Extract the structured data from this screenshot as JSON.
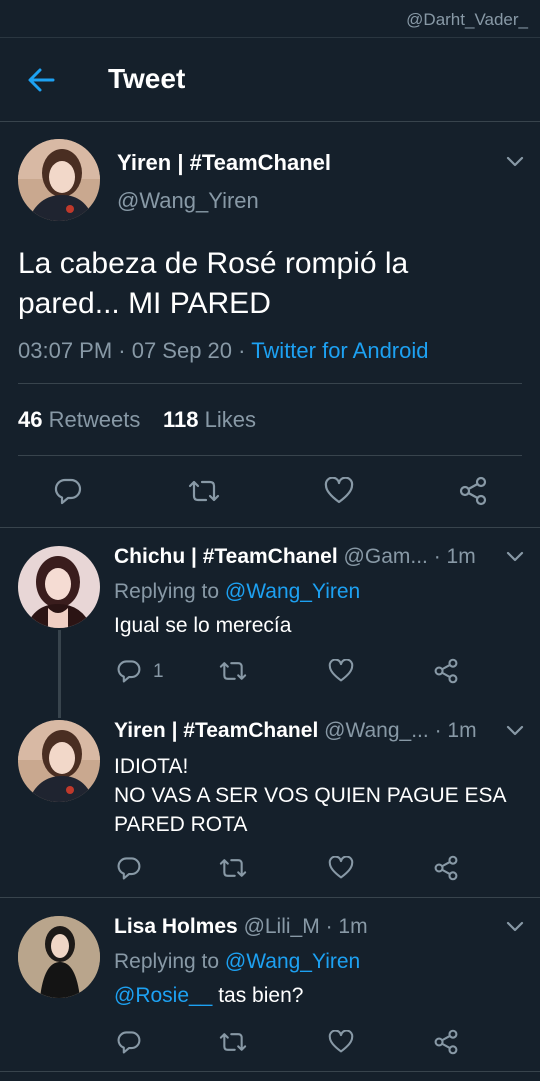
{
  "watermark": "@Darht_Vader_",
  "header": {
    "title": "Tweet"
  },
  "main_tweet": {
    "display_name": "Yiren | #TeamChanel",
    "handle": "@Wang_Yiren",
    "text_line1": "La cabeza de Rosé rompió la",
    "text_line2": "pared... MI PARED",
    "time": "03:07 PM · 07 Sep 20 · ",
    "source": "Twitter for Android",
    "retweets_count": "46",
    "retweets_label": "Retweets",
    "likes_count": "118",
    "likes_label": "Likes"
  },
  "replies": [
    {
      "display_name": "Chichu | #TeamChanel",
      "handle": "@Gam...",
      "time": "· 1m",
      "replying_prefix": "Replying to ",
      "replying_to": "@Wang_Yiren",
      "text": "Igual se lo merecía",
      "reply_count": "1"
    },
    {
      "display_name": "Yiren | #TeamChanel",
      "handle": "@Wang_...",
      "time": "· 1m",
      "text_line1": "IDIOTA!",
      "text_line2": "NO VAS A SER VOS QUIEN PAGUE ESA",
      "text_line3": "PARED ROTA"
    },
    {
      "display_name": "Lisa Holmes",
      "handle": "@Lili_M",
      "time": "· 1m",
      "replying_prefix": "Replying to ",
      "replying_to": "@Wang_Yiren",
      "mention": "@Rosie__",
      "text": " tas bien?"
    }
  ],
  "colors": {
    "background": "#15202b",
    "accent": "#1da1f2",
    "muted": "#8899a6",
    "divider": "#38444d"
  }
}
